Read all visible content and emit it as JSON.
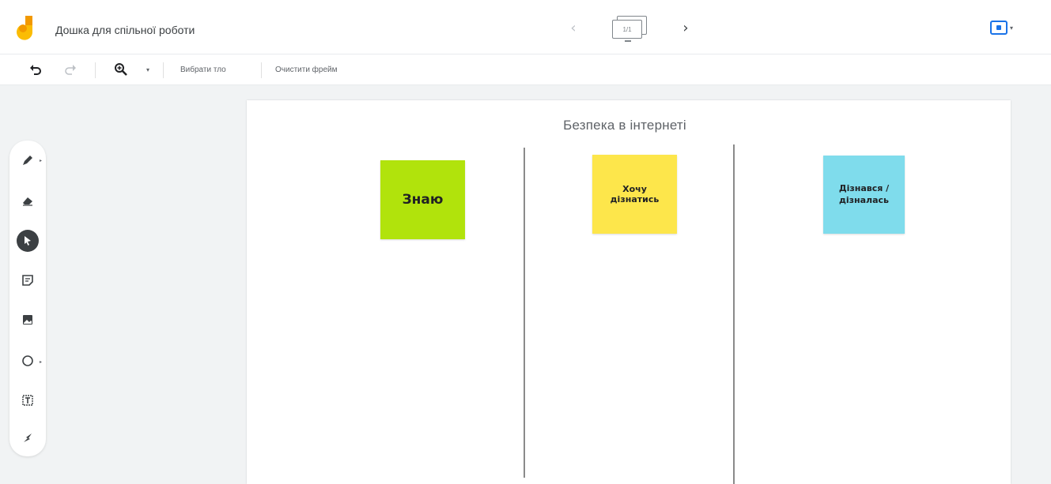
{
  "app": {
    "title": "Дошка для спільної роботи"
  },
  "toolbar": {
    "choose_background": "Вибрати тло",
    "clear_frame": "Очистити фрейм"
  },
  "frame_nav": {
    "thumb_label": "1/1"
  },
  "board": {
    "title": "Безпека в інтернеті",
    "stickies": [
      {
        "label": "Знаю",
        "color": "#b1e30c"
      },
      {
        "label": "Хочу дізнатись",
        "color": "#fde64b"
      },
      {
        "label": "Дізнався / дізналась",
        "color": "#7fdcec"
      }
    ]
  },
  "tools": [
    {
      "icon": "pen-icon"
    },
    {
      "icon": "eraser-icon"
    },
    {
      "icon": "select-icon",
      "selected": true
    },
    {
      "icon": "sticky-note-icon"
    },
    {
      "icon": "image-icon"
    },
    {
      "icon": "circle-icon"
    },
    {
      "icon": "text-box-icon"
    },
    {
      "icon": "laser-icon"
    }
  ],
  "colors": {
    "accent": "#1a73e8",
    "logo_yellow": "#fbbc04",
    "logo_orange": "#f29900"
  }
}
